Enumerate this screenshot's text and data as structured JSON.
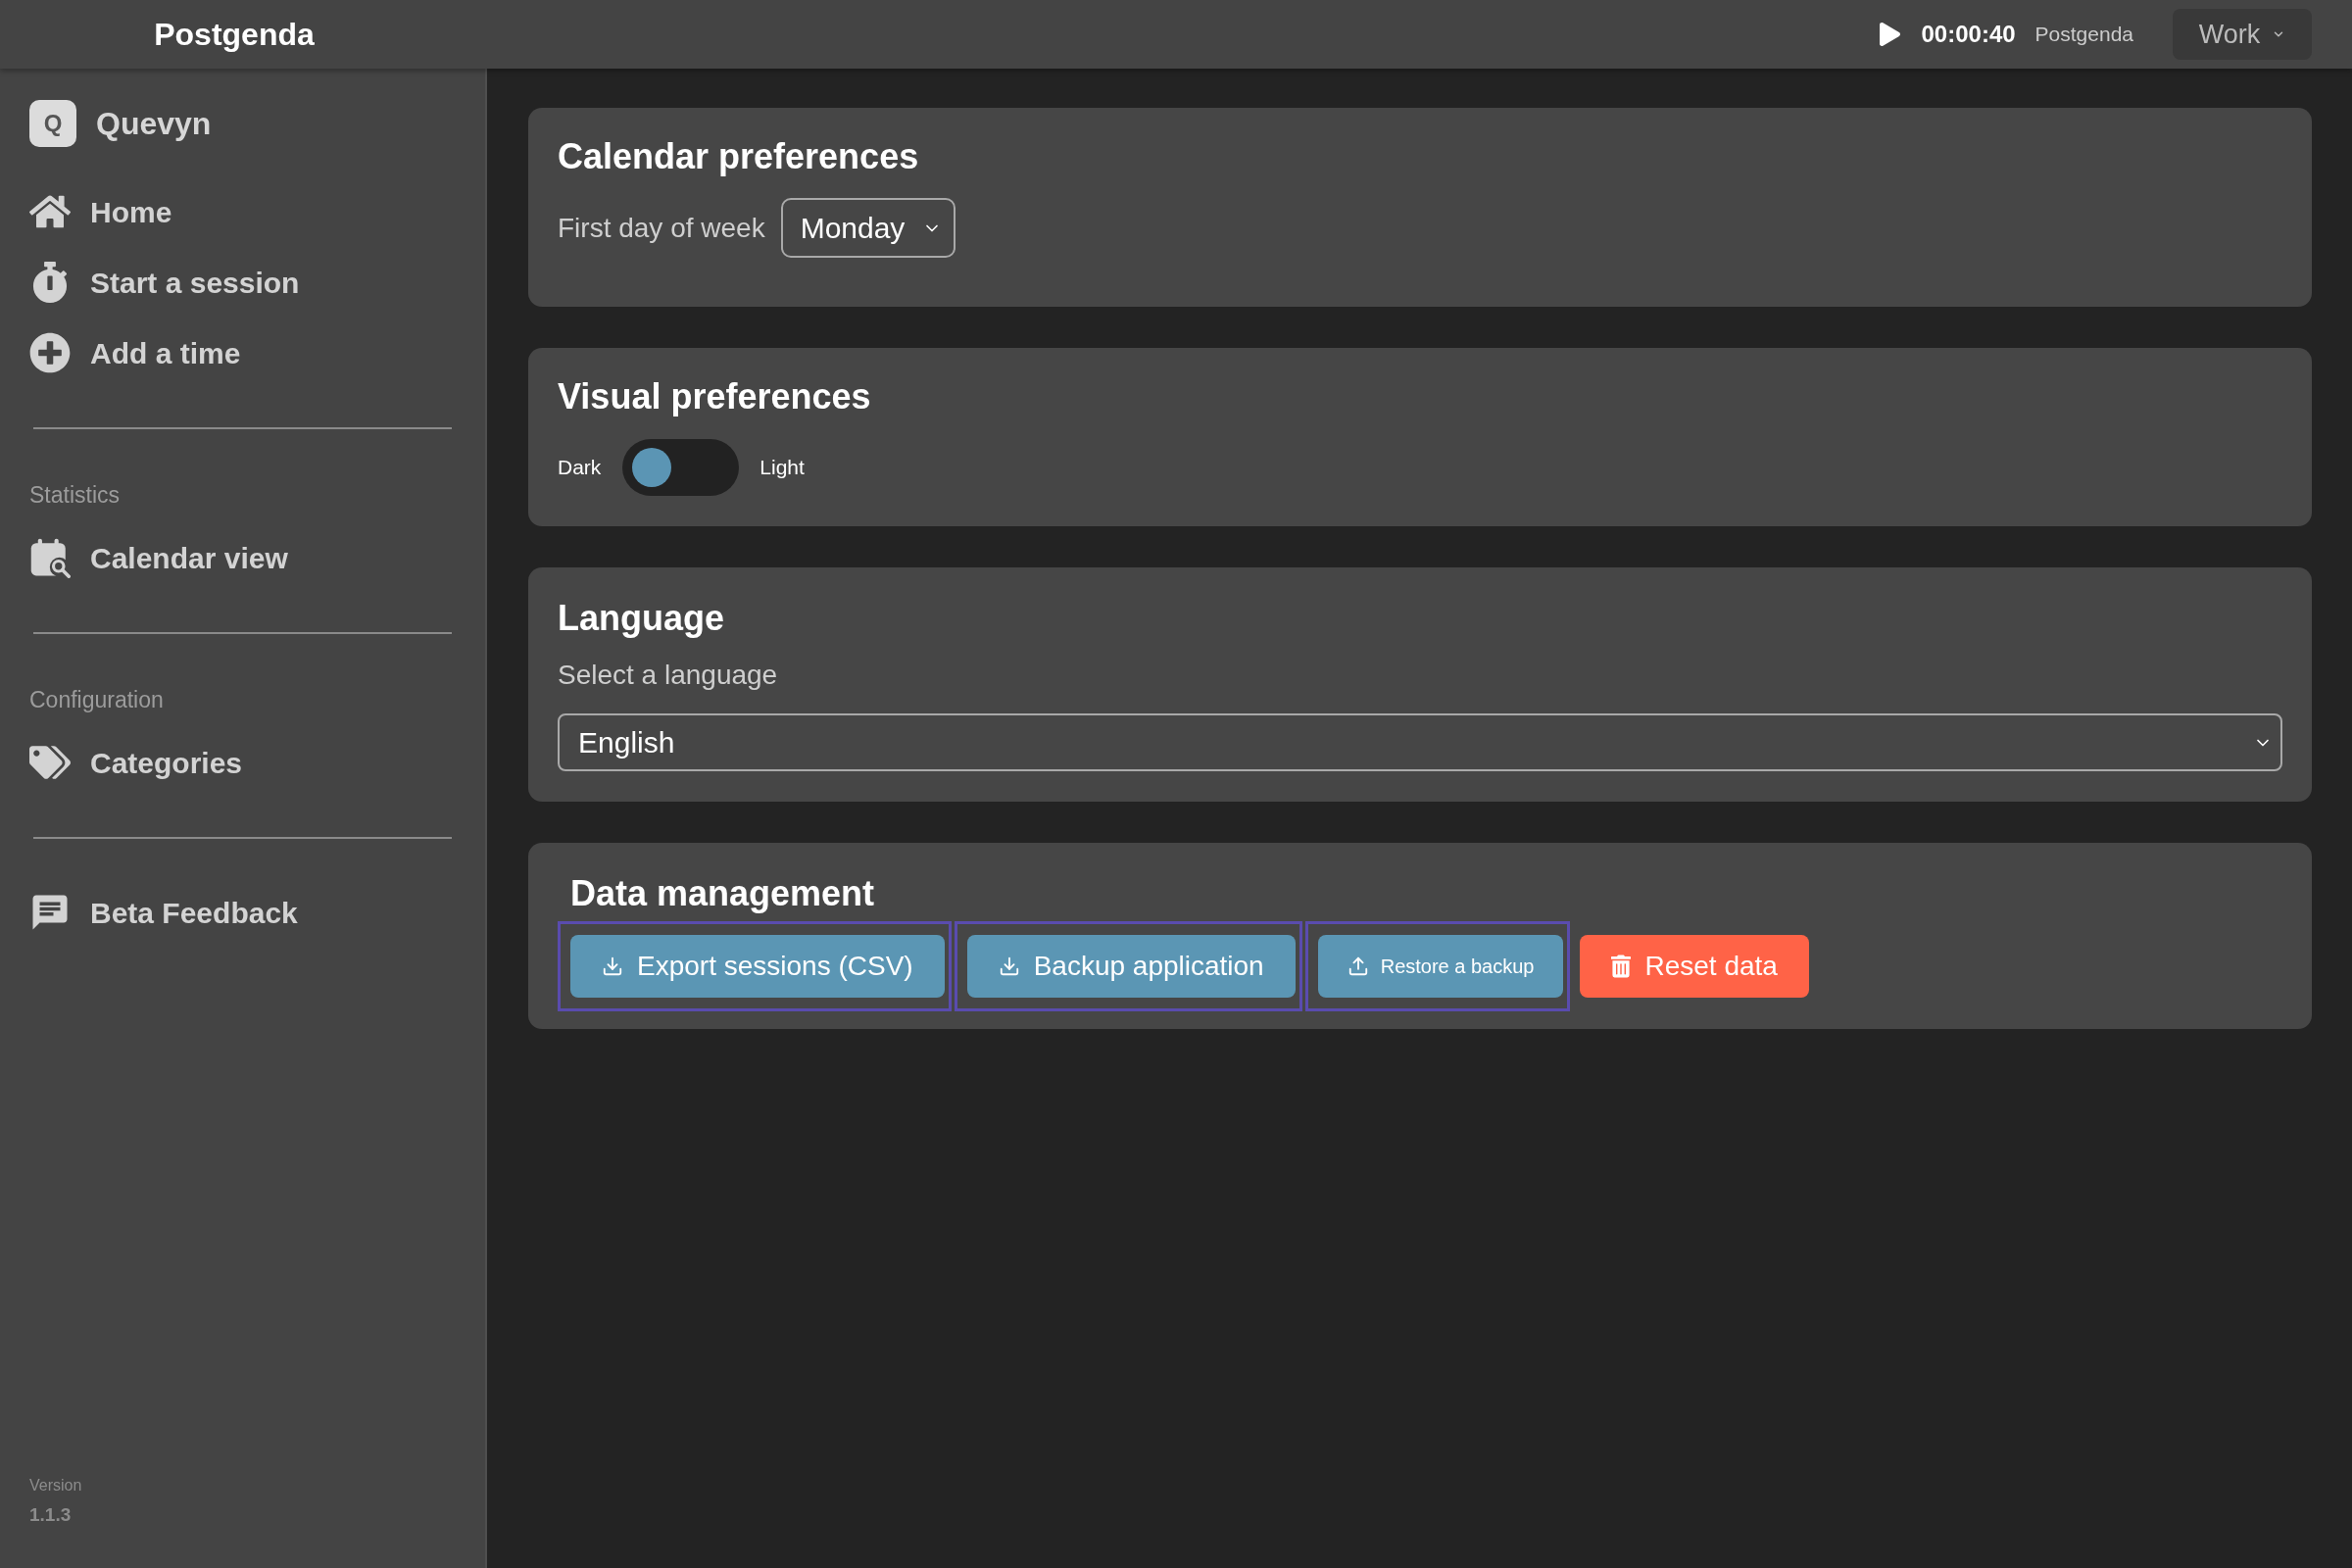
{
  "top_bar": {
    "title": "Postgenda",
    "timer": "00:00:40",
    "project": "Postgenda",
    "category_select": {
      "value": "Work"
    }
  },
  "sidebar": {
    "brand": {
      "logo": "Q",
      "name": "Quevyn"
    },
    "sections": [
      {
        "items": [
          {
            "label": "Home",
            "selected": false
          },
          {
            "label": "Start a session",
            "selected": false
          },
          {
            "label": "Add a time",
            "selected": false
          }
        ]
      },
      {
        "heading": "Statistics",
        "items": [
          {
            "label": "Calendar view",
            "selected": false
          }
        ]
      },
      {
        "heading": "Configuration",
        "items": [
          {
            "label": "Categories",
            "selected": false
          }
        ]
      },
      {
        "items": [
          {
            "label": "Beta Feedback",
            "selected": false
          }
        ]
      }
    ],
    "version": {
      "label": "Version",
      "value": "1.1.3"
    }
  },
  "calendar_preferences": {
    "title": "Calendar preferences",
    "first_day": {
      "label": "First day of week",
      "value": "Monday"
    }
  },
  "visual_preferences": {
    "title": "Visual preferences",
    "theme_switch": {
      "left_label": "Dark",
      "right_label": "Light",
      "on": false
    }
  },
  "language": {
    "title": "Language",
    "prompt": "Select a language",
    "select": {
      "value": "English"
    }
  },
  "data_management": {
    "title": "Data management",
    "buttons": [
      {
        "label": "Export sessions (CSV)",
        "kind": "download",
        "outlined": true
      },
      {
        "label": "Backup application",
        "kind": "download",
        "outlined": true
      },
      {
        "label": "Restore a backup",
        "kind": "upload",
        "outlined": true
      },
      {
        "label": "Reset data",
        "kind": "danger",
        "outlined": false
      }
    ]
  }
}
